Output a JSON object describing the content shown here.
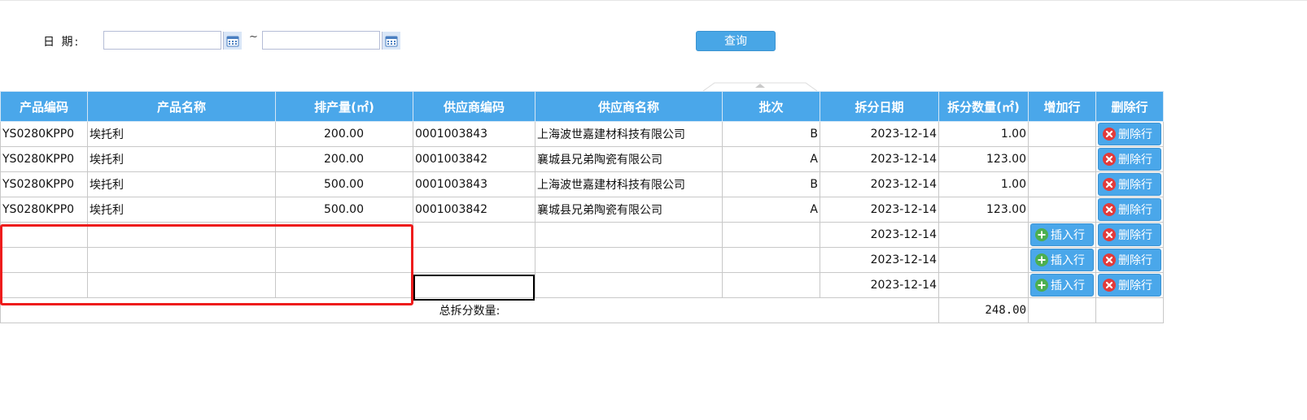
{
  "filter": {
    "date_label": "日 期:",
    "separator": "~",
    "from_value": "",
    "to_value": "",
    "query_label": "查询"
  },
  "table": {
    "headers": [
      "产品编码",
      "产品名称",
      "排产量(㎡)",
      "供应商编码",
      "供应商名称",
      "批次",
      "拆分日期",
      "拆分数量(㎡)",
      "增加行",
      "删除行"
    ],
    "rows": [
      {
        "product_code": "YS0280KPP0",
        "product_name": "埃托利",
        "output": "200.00",
        "supplier_code": "0001003843",
        "supplier_name": "上海波世嘉建材科技有限公司",
        "batch": "B",
        "split_date": "2023-12-14",
        "split_qty": "1.00",
        "insert": false
      },
      {
        "product_code": "YS0280KPP0",
        "product_name": "埃托利",
        "output": "200.00",
        "supplier_code": "0001003842",
        "supplier_name": "襄城县兄弟陶瓷有限公司",
        "batch": "A",
        "split_date": "2023-12-14",
        "split_qty": "123.00",
        "insert": false
      },
      {
        "product_code": "YS0280KPP0",
        "product_name": "埃托利",
        "output": "500.00",
        "supplier_code": "0001003843",
        "supplier_name": "上海波世嘉建材科技有限公司",
        "batch": "B",
        "split_date": "2023-12-14",
        "split_qty": "1.00",
        "insert": false
      },
      {
        "product_code": "YS0280KPP0",
        "product_name": "埃托利",
        "output": "500.00",
        "supplier_code": "0001003842",
        "supplier_name": "襄城县兄弟陶瓷有限公司",
        "batch": "A",
        "split_date": "2023-12-14",
        "split_qty": "123.00",
        "insert": false
      },
      {
        "product_code": "",
        "product_name": "",
        "output": "",
        "supplier_code": "",
        "supplier_name": "",
        "batch": "",
        "split_date": "2023-12-14",
        "split_qty": "",
        "insert": true
      },
      {
        "product_code": "",
        "product_name": "",
        "output": "",
        "supplier_code": "",
        "supplier_name": "",
        "batch": "",
        "split_date": "2023-12-14",
        "split_qty": "",
        "insert": true
      },
      {
        "product_code": "",
        "product_name": "",
        "output": "",
        "supplier_code": "",
        "supplier_name": "",
        "batch": "",
        "split_date": "2023-12-14",
        "split_qty": "",
        "insert": true
      }
    ],
    "insert_label": "插入行",
    "delete_label": "删除行",
    "total_label": "总拆分数量:",
    "total_value": "248.00"
  },
  "colors": {
    "header_bg": "#4aa7ea",
    "button_bg": "#4aa7ea",
    "insert_icon": "#4caf50",
    "delete_icon": "#e23b3b",
    "highlight": "#ee1c1c"
  },
  "icons": {
    "calendar": "calendar-icon",
    "insert": "plus-circle-icon",
    "delete": "x-circle-icon"
  }
}
